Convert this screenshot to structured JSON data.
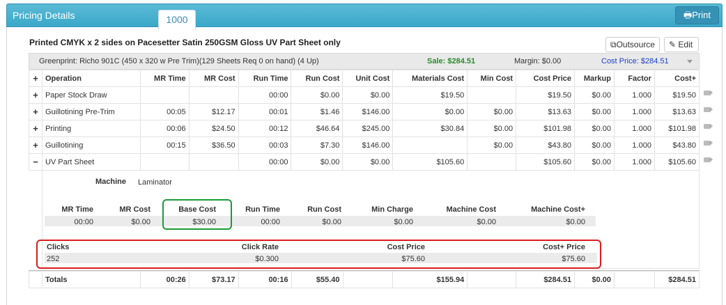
{
  "header": {
    "title": "Pricing Details",
    "active_tab": "1000",
    "print_label": "Print"
  },
  "job": {
    "title": "Printed CMYK x 2 sides on Pacesetter Satin 250GSM Gloss UV Part Sheet only",
    "outsource_label": "Outsource",
    "edit_label": "Edit"
  },
  "machine_bar": {
    "name": "Greenprint: Richo 901C (450 x 320 w Pre Trim)(129 Sheets Req 0 on hand) (4 Up)",
    "sale": "Sale: $284.51",
    "margin": "Margin: $0.00",
    "cost_price": "Cost Price: $284.51"
  },
  "columns": [
    "Operation",
    "MR Time",
    "MR Cost",
    "Run Time",
    "Run Cost",
    "Unit Cost",
    "Materials Cost",
    "Min Cost",
    "Cost Price",
    "Markup",
    "Factor",
    "Cost+"
  ],
  "rows": [
    {
      "toggle": "+",
      "cells": [
        "Paper Stock Draw",
        "",
        "",
        "00:00",
        "$0.00",
        "$0.00",
        "$19.50",
        "",
        "$19.50",
        "$0.00",
        "1.000",
        "$19.50"
      ]
    },
    {
      "toggle": "+",
      "cells": [
        "Guillotining Pre-Trim",
        "00:05",
        "$12.17",
        "00:01",
        "$1.46",
        "$146.00",
        "$0.00",
        "$0.00",
        "$13.63",
        "$0.00",
        "1.000",
        "$13.63"
      ]
    },
    {
      "toggle": "+",
      "cells": [
        "Printing",
        "00:06",
        "$24.50",
        "00:12",
        "$46.64",
        "$245.00",
        "$30.84",
        "$0.00",
        "$101.98",
        "$0.00",
        "1.000",
        "$101.98"
      ]
    },
    {
      "toggle": "+",
      "cells": [
        "Guillotining",
        "00:15",
        "$36.50",
        "00:03",
        "$7.30",
        "$146.00",
        "",
        "$0.00",
        "$43.80",
        "$0.00",
        "1.000",
        "$43.80"
      ]
    },
    {
      "toggle": "−",
      "cells": [
        "UV Part Sheet",
        "",
        "",
        "00:00",
        "$0.00",
        "$0.00",
        "$105.60",
        "",
        "$105.60",
        "$0.00",
        "1.000",
        "$105.60"
      ]
    }
  ],
  "detail": {
    "machine_label": "Machine",
    "machine_value": "Laminator",
    "headers": [
      "MR Time",
      "MR Cost",
      "Base Cost",
      "Run Time",
      "Run Cost",
      "Min Charge",
      "Machine Cost",
      "Machine Cost+"
    ],
    "values": [
      "00:00",
      "$0.00",
      "$30.00",
      "00:00",
      "$0.00",
      "$0.00",
      "$0.00",
      "$0.00"
    ],
    "clicks": {
      "headers": [
        "Clicks",
        "Click Rate",
        "Cost Price",
        "Cost+ Price"
      ],
      "values": [
        "252",
        "$0.300",
        "$75.60",
        "$75.60"
      ]
    }
  },
  "totals": {
    "label": "Totals",
    "cells": [
      "00:26",
      "$73.17",
      "00:16",
      "$55.40",
      "",
      "$155.94",
      "",
      "$284.51",
      "$0.00",
      "",
      "$284.51"
    ]
  },
  "colors": {
    "header_bg": "#3aa8c9",
    "sale_green": "#2a8a2a",
    "cost_blue": "#1a3fc7",
    "highlight_green": "#1a9a3a",
    "highlight_red": "#d81e1e"
  }
}
